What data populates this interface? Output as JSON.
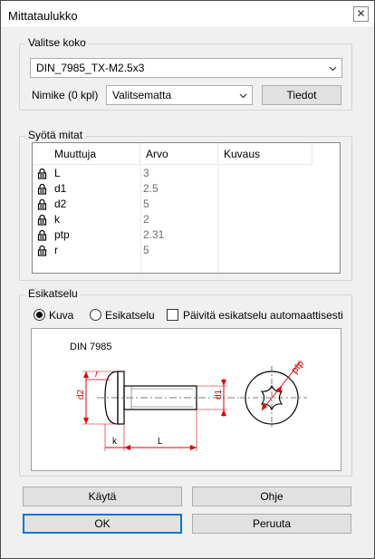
{
  "window": {
    "title": "Mittataulukko",
    "close_glyph": "✕"
  },
  "size_group": {
    "label": "Valitse koko",
    "size_select_value": "DIN_7985_TX-M2.5x3",
    "name_label": "Nimike (0 kpl)",
    "name_select_value": "Valitsematta",
    "info_button": "Tiedot"
  },
  "dims_group": {
    "label": "Syötä mitat",
    "columns": [
      "Muuttuja",
      "Arvo",
      "Kuvaus"
    ],
    "rows": [
      {
        "name": "L",
        "value": "3",
        "desc": ""
      },
      {
        "name": "d1",
        "value": "2.5",
        "desc": ""
      },
      {
        "name": "d2",
        "value": "5",
        "desc": ""
      },
      {
        "name": "k",
        "value": "2",
        "desc": ""
      },
      {
        "name": "ptp",
        "value": "2.31",
        "desc": ""
      },
      {
        "name": "r",
        "value": "5",
        "desc": ""
      }
    ]
  },
  "preview_group": {
    "label": "Esikatselu",
    "radio_image": "Kuva",
    "radio_preview": "Esikatselu",
    "radio_selected": "Kuva",
    "auto_update_label": "Päivitä esikatselu automaattisesti",
    "auto_update_checked": false,
    "drawing": {
      "title": "DIN 7985",
      "labels": {
        "r": "r",
        "d2": "d2",
        "d1": "d1",
        "k": "k",
        "L": "L",
        "ptp": "ptp"
      },
      "dim_color": "#e00000"
    }
  },
  "buttons": {
    "apply": "Käytä",
    "help": "Ohje",
    "ok": "OK",
    "cancel": "Peruuta"
  },
  "icons": {
    "lock": "lock-icon",
    "chevron": "chevron-down-icon",
    "close": "close-icon"
  }
}
